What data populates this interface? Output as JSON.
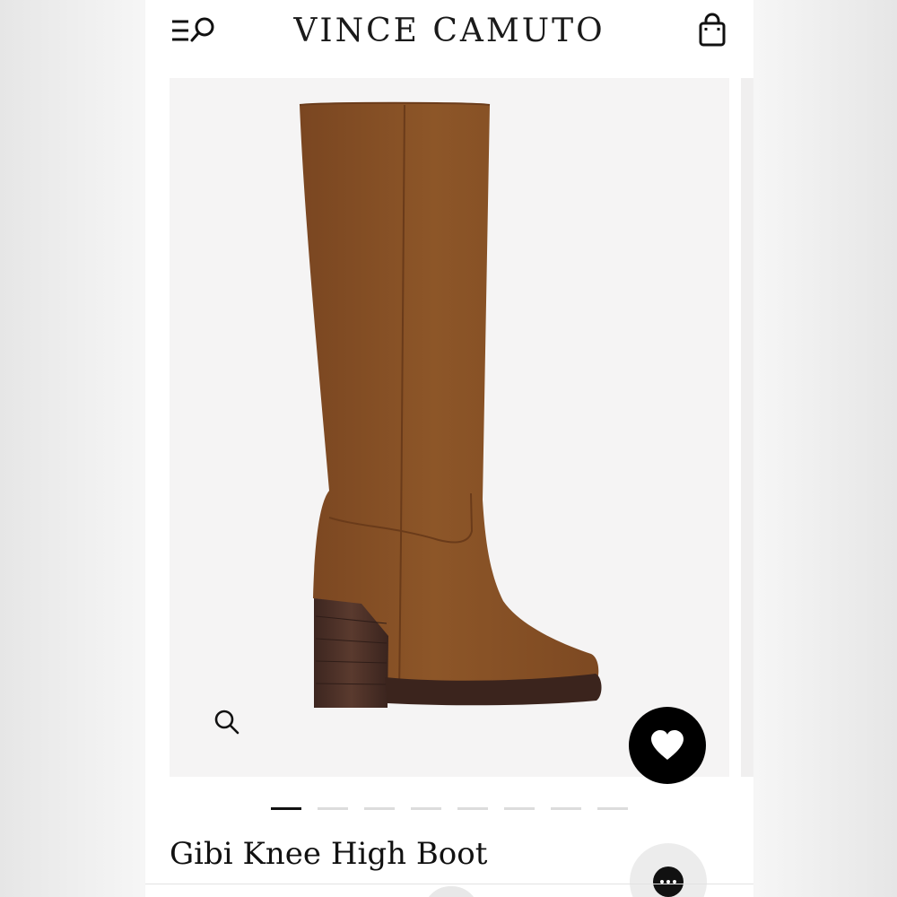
{
  "header": {
    "brand": "VINCE CAMUTO",
    "icons": {
      "menu_search": "menu-search-icon",
      "bag": "shopping-bag-icon"
    }
  },
  "product": {
    "title": "Gibi Knee High Boot",
    "image": {
      "subject": "brown-suede-knee-high-boot",
      "current_slide": 1,
      "total_slides": 8
    }
  },
  "actions": {
    "zoom": "zoom-icon",
    "favorite": "heart-icon",
    "chat": "chat-more-icon"
  },
  "colors": {
    "boot": "#8b5426",
    "heel": "#4a3027",
    "fav_button": "#000000",
    "active_dot": "#111111"
  }
}
